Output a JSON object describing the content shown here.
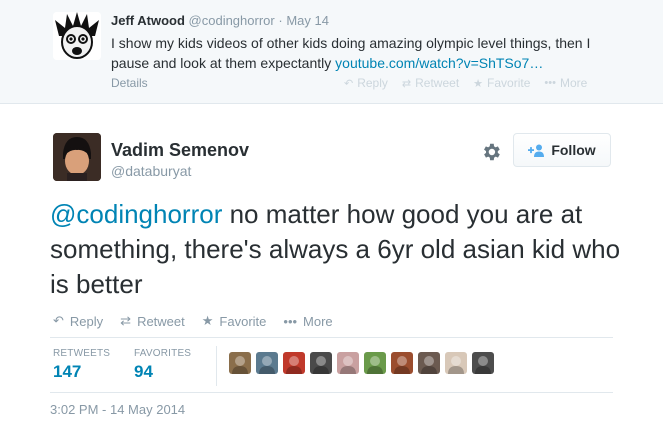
{
  "parent_tweet": {
    "fullname": "Jeff Atwood",
    "screenname": "@codinghorror",
    "separator": "·",
    "date": "May 14",
    "text": "I show my kids videos of other kids doing amazing olympic level things, then I pause and look at them expectantly ",
    "link": "youtube.com/watch?v=ShTSo7…",
    "details_label": "Details",
    "actions": {
      "reply": "Reply",
      "retweet": "Retweet",
      "favorite": "Favorite",
      "more": "More"
    }
  },
  "tweet": {
    "fullname": "Vadim Semenov",
    "screenname": "@databuryat",
    "follow_label": "Follow",
    "mention": "@codinghorror",
    "text": " no matter how good you are at something, there's always a 6yr old asian kid who is better",
    "actions": {
      "reply": "Reply",
      "retweet": "Retweet",
      "favorite": "Favorite",
      "more": "More"
    },
    "stats": {
      "retweets_label": "RETWEETS",
      "retweets_count": "147",
      "favorites_label": "FAVORITES",
      "favorites_count": "94"
    },
    "timestamp": "3:02 PM - 14 May 2014"
  },
  "favoriter_avatar_colors": [
    "#8a6e4b",
    "#5b7a8f",
    "#c0392b",
    "#4a4a4a",
    "#c9a0a0",
    "#6a9a4a",
    "#9b4d2e",
    "#6b5a50",
    "#d8c8b8",
    "#4d4d4d"
  ],
  "colors": {
    "link": "#0084b4",
    "muted": "#8899a6",
    "text": "#292f33",
    "follow_icon": "#55acee"
  }
}
